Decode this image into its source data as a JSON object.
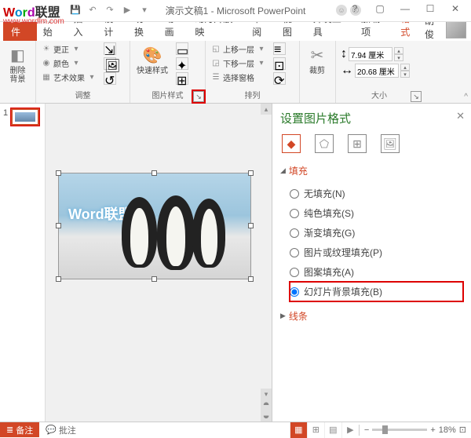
{
  "titlebar": {
    "logo_text": "Word联盟",
    "url": "www.wordlm.com",
    "doc_title": "演示文稿1 - Microsoft PowerPoint"
  },
  "tabs": {
    "file": "文件",
    "items": [
      "开始",
      "插入",
      "设计",
      "切换",
      "动画",
      "幻灯片放映",
      "审阅",
      "视图",
      "开发工具",
      "加载项",
      "格式"
    ],
    "active_index": 10,
    "user_name": "胡俊"
  },
  "ribbon": {
    "remove_bg": "删除背景",
    "corrections": "更正",
    "color": "颜色",
    "artistic": "艺术效果",
    "adjust_label": "调整",
    "quick_styles": "快速样式",
    "picture_styles_label": "图片样式",
    "bring_forward": "上移一层",
    "send_backward": "下移一层",
    "selection_pane": "选择窗格",
    "arrange_label": "排列",
    "crop": "裁剪",
    "height_value": "7.94 厘米",
    "width_value": "20.68 厘米",
    "size_label": "大小"
  },
  "thumb": {
    "num": "1"
  },
  "slide_watermark": "Word联盟",
  "pane": {
    "title": "设置图片格式",
    "section_fill": "填充",
    "opts": {
      "no_fill": "无填充(N)",
      "solid": "纯色填充(S)",
      "gradient": "渐变填充(G)",
      "picture": "图片或纹理填充(P)",
      "pattern": "图案填充(A)",
      "slide_bg": "幻灯片背景填充(B)"
    },
    "section_line": "线条"
  },
  "status": {
    "notes": "备注",
    "comments": "批注",
    "zoom": "18%"
  }
}
